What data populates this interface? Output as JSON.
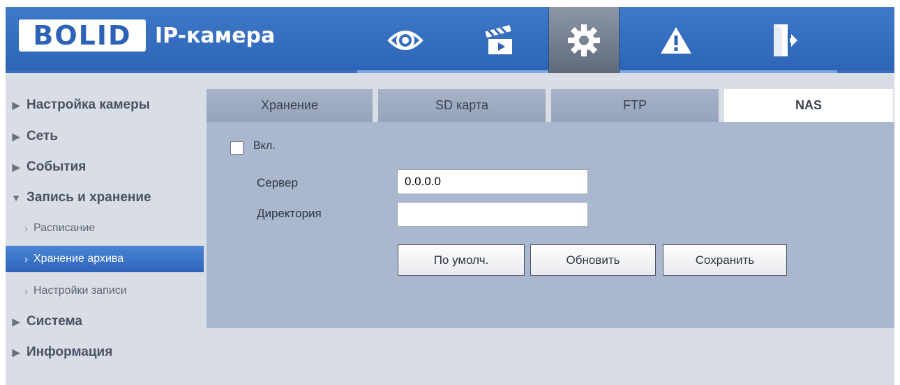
{
  "header": {
    "logo_text": "BOLID",
    "product_name": "IP-камера",
    "nav_icons": [
      {
        "name": "eye-icon",
        "active": false
      },
      {
        "name": "clapperboard-icon",
        "active": false
      },
      {
        "name": "gear-icon",
        "active": true
      },
      {
        "name": "warning-icon",
        "active": false
      },
      {
        "name": "logout-icon",
        "active": false
      }
    ]
  },
  "sidebar": {
    "items": [
      {
        "label": "Настройка камеры",
        "expanded": false
      },
      {
        "label": "Сеть",
        "expanded": false
      },
      {
        "label": "События",
        "expanded": false
      },
      {
        "label": "Запись и хранение",
        "expanded": true
      },
      {
        "label": "Система",
        "expanded": false
      },
      {
        "label": "Информация",
        "expanded": false
      }
    ],
    "subitems": [
      {
        "label": "Расписание",
        "active": false
      },
      {
        "label": "Хранение архива",
        "active": true
      },
      {
        "label": "Настройки записи",
        "active": false
      }
    ]
  },
  "tabs": [
    {
      "label": "Хранение",
      "active": false
    },
    {
      "label": "SD карта",
      "active": false
    },
    {
      "label": "FTP",
      "active": false
    },
    {
      "label": "NAS",
      "active": true
    }
  ],
  "form": {
    "enable_label": "Вкл.",
    "enable_checked": false,
    "server_label": "Сервер",
    "server_value": "0.0.0.0",
    "directory_label": "Директория",
    "directory_value": ""
  },
  "buttons": {
    "default_label": "По умолч.",
    "refresh_label": "Обновить",
    "save_label": "Сохранить"
  },
  "colors": {
    "header_blue": "#2c63b6",
    "active_sidebar": "#3a72c8",
    "panel_bg": "#aab8cf"
  }
}
